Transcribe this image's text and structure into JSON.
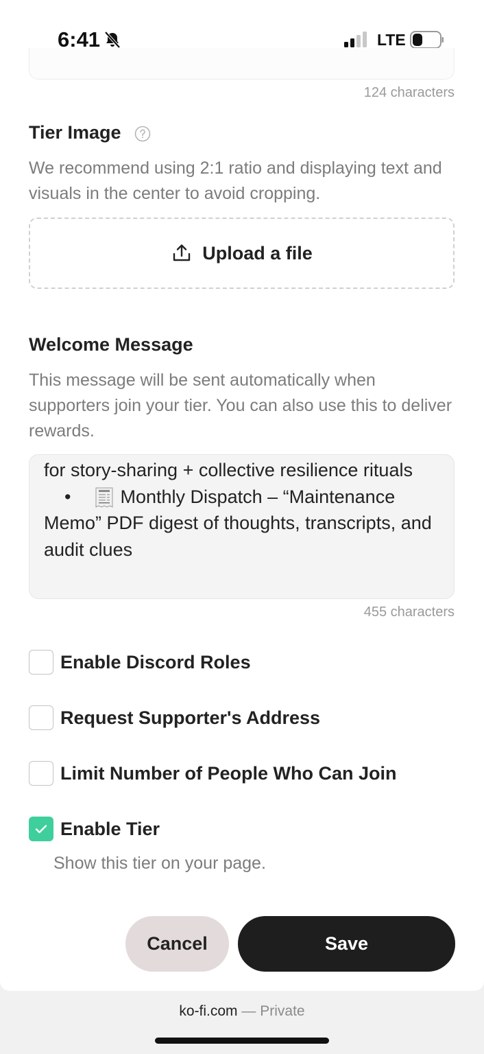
{
  "status_bar": {
    "time": "6:41",
    "network": "LTE",
    "bell_icon": "bell-slash-icon",
    "battery_icon": "battery-icon",
    "signal_icon": "cellular-signal-icon"
  },
  "previous_field": {
    "char_count": "124 characters"
  },
  "tier_image": {
    "title": "Tier Image",
    "help_icon": "question-circle-icon",
    "description": "We recommend using 2:1 ratio and displaying text and visuals in the center to avoid cropping.",
    "upload_label": "Upload a file",
    "upload_icon": "upload-icon"
  },
  "welcome_message": {
    "title": "Welcome Message",
    "description": "This message will be sent automatically when supporters join your tier. You can also use this to deliver rewards.",
    "visible_lines": {
      "line1": "for story-sharing + collective resilience rituals",
      "bullet": "•",
      "bullet_icon": "receipt-icon",
      "line2": "Monthly Dispatch – “Maintenance Memo” PDF digest of thoughts, transcripts, and audit clues"
    },
    "char_count": "455 characters"
  },
  "options": [
    {
      "label": "Enable Discord Roles",
      "checked": false
    },
    {
      "label": "Request Supporter's Address",
      "checked": false
    },
    {
      "label": "Limit Number of People Who Can Join",
      "checked": false
    },
    {
      "label": "Enable Tier",
      "checked": true,
      "sublabel": "Show this tier on your page."
    }
  ],
  "actions": {
    "cancel_label": "Cancel",
    "save_label": "Save"
  },
  "browser": {
    "domain": "ko-fi.com",
    "separator": "—",
    "mode": "Private"
  },
  "colors": {
    "accent_green": "#3ecf9d",
    "save_button": "#1e1e1e",
    "cancel_button": "#e3dbdb",
    "muted_text": "#7c7c7c"
  }
}
